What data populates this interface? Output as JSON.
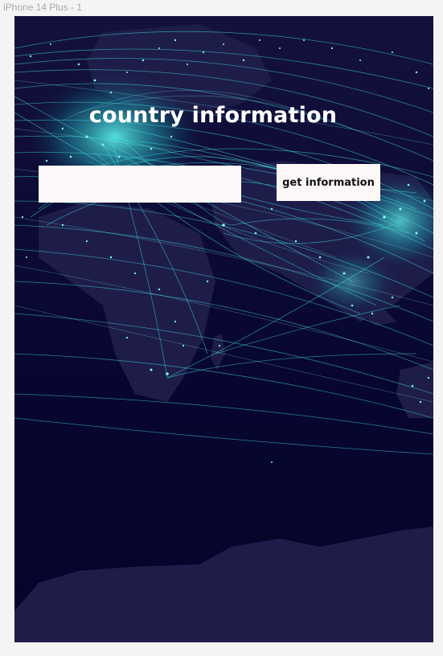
{
  "frame": {
    "label": "iPhone 14 Plus - 1"
  },
  "screen": {
    "title": "country information",
    "input": {
      "value": "",
      "placeholder": ""
    },
    "button_label": "get information"
  },
  "colors": {
    "background": "#06052a",
    "land": "#1e1d4a",
    "routes": "#3fe0e0",
    "panel": "#fdf8f8"
  }
}
